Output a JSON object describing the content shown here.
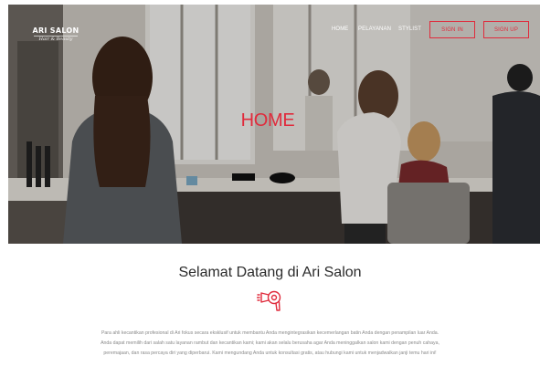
{
  "brand": {
    "name": "ARI SALON",
    "tagline": "Hair & Beauty"
  },
  "nav": {
    "items": [
      "HOME",
      "PELAYANAN",
      "STYLIST"
    ],
    "signin_label": "SIGN IN",
    "signup_label": "SIGN UP"
  },
  "hero": {
    "title": "HOME"
  },
  "welcome": {
    "title": "Selamat Datang di Ari Salon",
    "icon": "hair-dryer-icon",
    "lines": [
      "Para ahli kecantikan profesional di Ari fokus secara eksklusif untuk membantu Anda mengintegrasikan kecemerlangan batin Anda dengan penampilan luar Anda.",
      "Anda dapat memilih dari salah satu layanan rambut dan kecantikan kami; kami akan selalu berusaha agar Anda meninggalkan salon kami dengan penuh cahaya,",
      "peremajaan, dan rasa percaya diri yang diperbarui. Kami mengundang Anda untuk konsultasi gratis, atau hubungi kami untuk menjadwalkan janji temu hari ini!"
    ]
  },
  "colors": {
    "accent": "#e02b3c",
    "text": "#2b2b2b",
    "muted": "#8a8a8a"
  }
}
